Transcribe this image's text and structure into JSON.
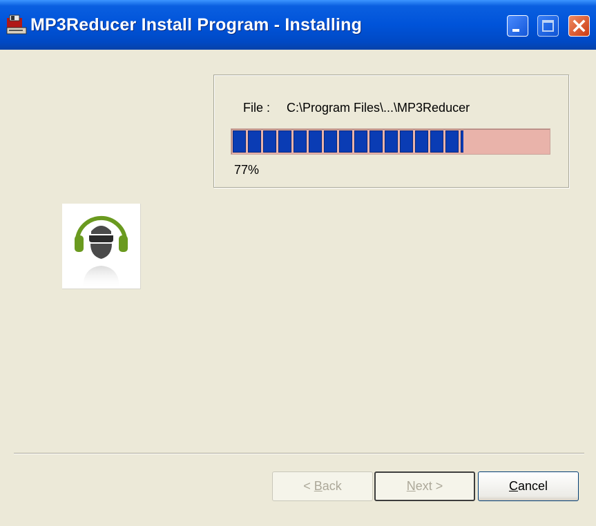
{
  "window": {
    "title": "MP3Reducer Install Program - Installing"
  },
  "install": {
    "file_label": "File :",
    "file_path": "C:\\Program Files\\...\\MP3Reducer",
    "progress": 0.77,
    "progress_text": "77%"
  },
  "buttons": {
    "back": {
      "prefix": "< ",
      "hotkey": "B",
      "rest": "ack"
    },
    "next": {
      "hotkey": "N",
      "rest": "ext >"
    },
    "cancel": {
      "hotkey": "C",
      "rest": "ancel"
    }
  },
  "colors": {
    "progress_fill": "#0a3cb4",
    "progress_track": "#e9b3aa",
    "logo_green": "#6a9a1f",
    "logo_gray": "#4a4a4a"
  },
  "icons": {
    "title": "installer-floppy-icon",
    "logo": "headphones-user-logo"
  }
}
